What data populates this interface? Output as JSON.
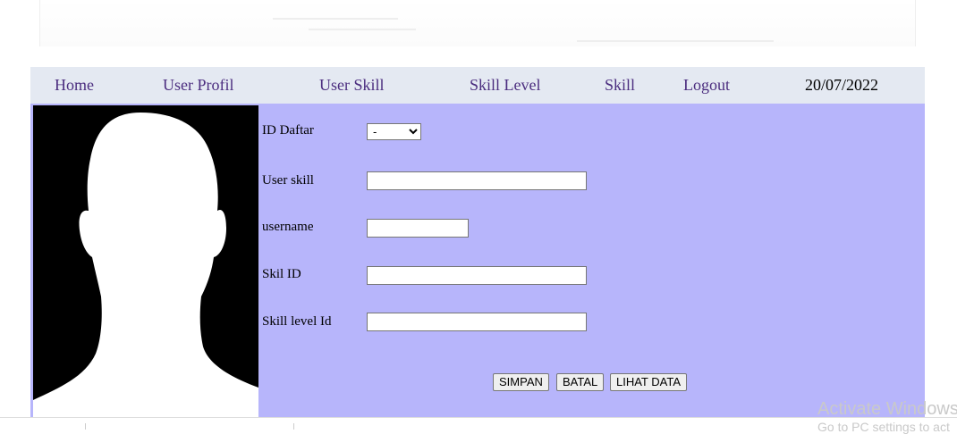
{
  "nav": {
    "items": [
      {
        "label": "Home"
      },
      {
        "label": "User Profil"
      },
      {
        "label": "User Skill"
      },
      {
        "label": "Skill Level"
      },
      {
        "label": "Skill"
      },
      {
        "label": "Logout"
      }
    ],
    "date": "20/07/2022"
  },
  "form": {
    "id_daftar_label": "ID Daftar",
    "id_daftar_value": "-",
    "user_skill_label": "User skill",
    "user_skill_value": "",
    "username_label": "username",
    "username_value": "",
    "skil_id_label": "Skil ID",
    "skil_id_value": "",
    "skill_level_id_label": "Skill level Id",
    "skill_level_id_value": ""
  },
  "buttons": {
    "save": "SIMPAN",
    "cancel": "BATAL",
    "view": "LIHAT DATA"
  },
  "watermark": {
    "line1": "Activate Windows",
    "line2": "Go to PC settings to act"
  },
  "colors": {
    "nav_bg": "#e4e9f2",
    "nav_link": "#4b2d7f",
    "panel_bg": "#b7b5fb"
  },
  "icons": {
    "profile_photo": "silhouette-avatar"
  }
}
